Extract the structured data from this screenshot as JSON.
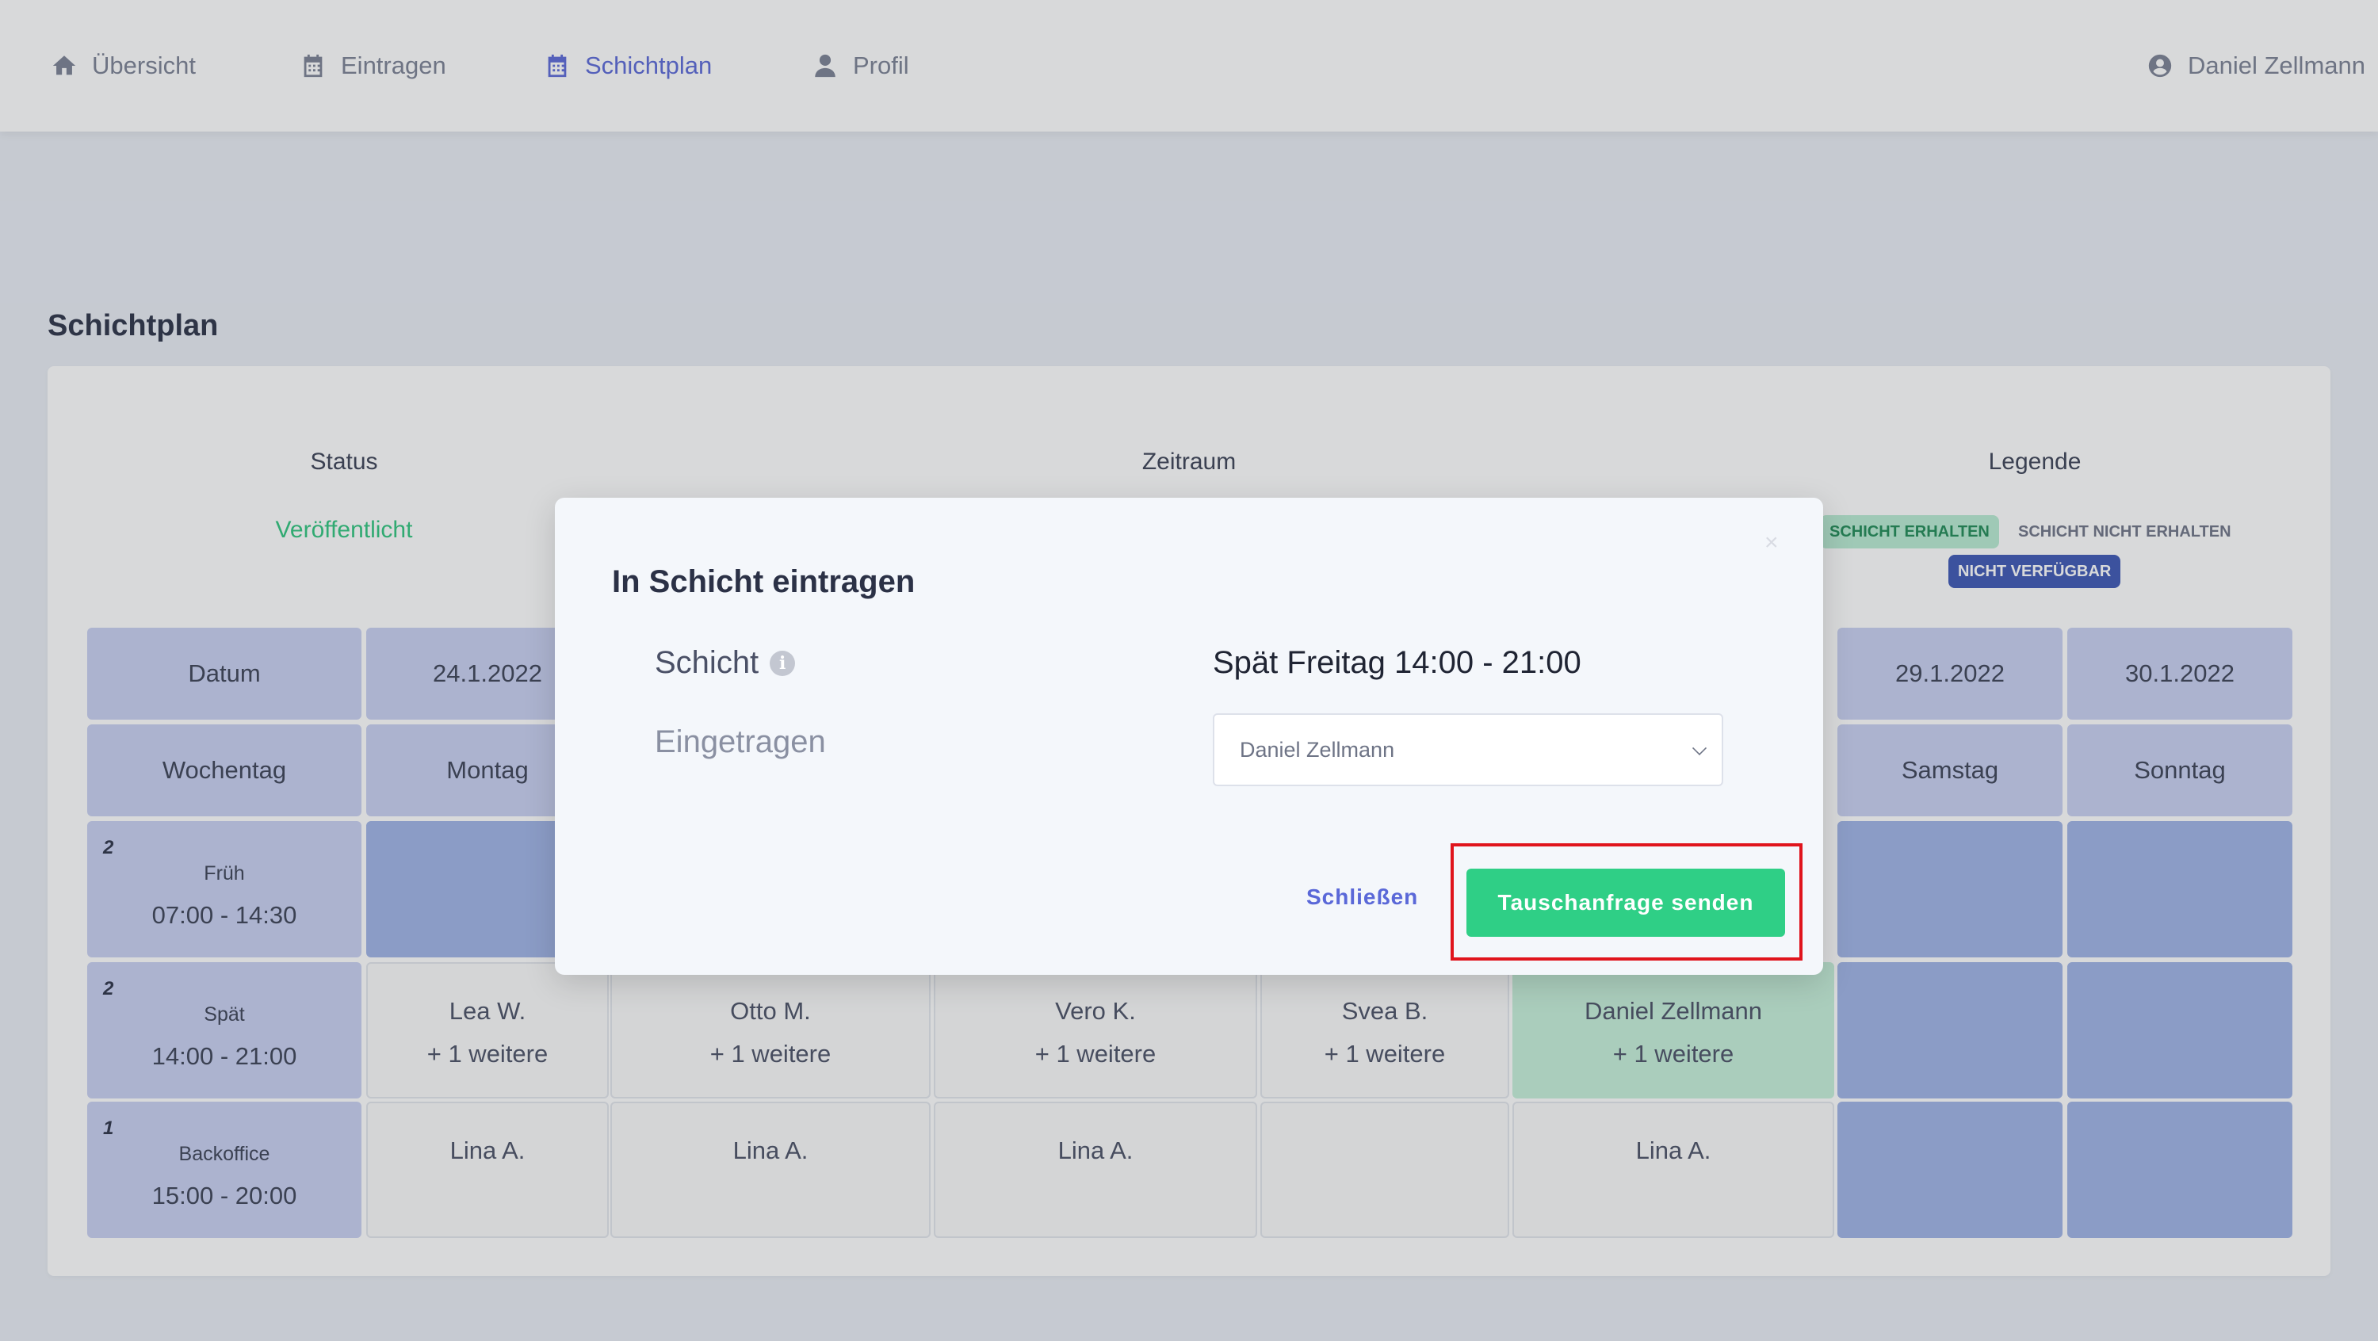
{
  "nav": {
    "items": [
      {
        "label": "Übersicht",
        "icon": "home-icon"
      },
      {
        "label": "Eintragen",
        "icon": "calendar-icon"
      },
      {
        "label": "Schichtplan",
        "icon": "calendar-icon"
      },
      {
        "label": "Profil",
        "icon": "user-icon"
      }
    ],
    "active": "Schichtplan",
    "user": {
      "label": "Daniel Zellmann",
      "icon": "user-circle-icon"
    }
  },
  "page": {
    "title": "Schichtplan"
  },
  "info": {
    "status_heading": "Status",
    "status_value": "Veröffentlicht",
    "period_heading": "Zeitraum",
    "legend_heading": "Legende",
    "legend": {
      "received": "SCHICHT ERHALTEN",
      "not_received": "SCHICHT NICHT ERHALTEN",
      "unavailable": "NICHT VERFÜGBAR"
    }
  },
  "table": {
    "row_labels": {
      "date": "Datum",
      "weekday": "Wochentag"
    },
    "dates": [
      "24.1.2022",
      "",
      "",
      "",
      "",
      "29.1.2022",
      "30.1.2022"
    ],
    "weekdays": [
      "Montag",
      "",
      "",
      "",
      "",
      "Samstag",
      "Sonntag"
    ],
    "shifts": [
      {
        "count": "2",
        "name": "Früh",
        "time": "07:00 - 14:30",
        "cells": [
          {
            "line1": "",
            "line2": ""
          },
          {
            "line1": "",
            "line2": ""
          },
          {
            "line1": "",
            "line2": ""
          },
          {
            "line1": "",
            "line2": ""
          },
          {
            "line1": "",
            "line2": ""
          },
          {
            "line1": "",
            "line2": ""
          },
          {
            "line1": "",
            "line2": ""
          }
        ]
      },
      {
        "count": "2",
        "name": "Spät",
        "time": "14:00 - 21:00",
        "cells": [
          {
            "line1": "Lea W.",
            "line2": "+ 1 weitere"
          },
          {
            "line1": "Otto M.",
            "line2": "+ 1 weitere"
          },
          {
            "line1": "Vero K.",
            "line2": "+ 1 weitere"
          },
          {
            "line1": "Svea B.",
            "line2": "+ 1 weitere"
          },
          {
            "line1": "Daniel Zellmann",
            "line2": "+ 1 weitere"
          },
          {
            "line1": "",
            "line2": ""
          },
          {
            "line1": "",
            "line2": ""
          }
        ]
      },
      {
        "count": "1",
        "name": "Backoffice",
        "time": "15:00 - 20:00",
        "cells": [
          {
            "line1": "Lina A.",
            "line2": ""
          },
          {
            "line1": "Lina A.",
            "line2": ""
          },
          {
            "line1": "Lina A.",
            "line2": ""
          },
          {
            "line1": "",
            "line2": ""
          },
          {
            "line1": "Lina A.",
            "line2": ""
          },
          {
            "line1": "",
            "line2": ""
          },
          {
            "line1": "",
            "line2": ""
          }
        ]
      }
    ]
  },
  "modal": {
    "title": "In Schicht eintragen",
    "close_symbol": "×",
    "shift_label": "Schicht",
    "shift_value": "Spät Freitag 14:00 - 21:00",
    "assigned_label": "Eingetragen",
    "assigned_value": "Daniel Zellmann",
    "close_button": "Schließen",
    "submit_button": "Tauschanfrage senden"
  },
  "colors": {
    "accent": "#5a68d8",
    "success": "#2fcf86",
    "header_cell": "#c8d0f2",
    "blocked_cell": "#9fb3e6",
    "own_shift": "#c6f1da",
    "highlight": "#e0141c"
  }
}
